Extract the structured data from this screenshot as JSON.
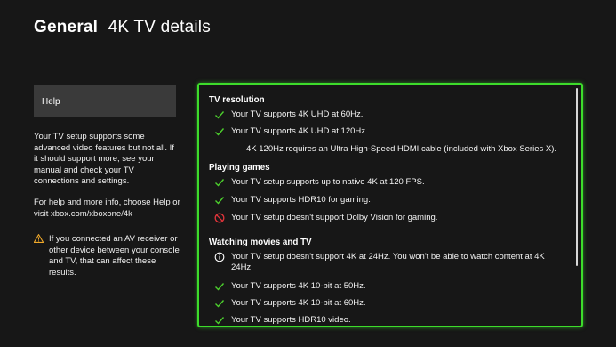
{
  "header": {
    "section": "General",
    "title": "4K TV details"
  },
  "help": {
    "button_label": "Help",
    "paragraph1": "Your TV setup supports some advanced video features but not all. If it should support more, see your manual and check your TV connections and settings.",
    "paragraph2": "For help and more info, choose Help or visit xbox.com/xboxone/4k",
    "warning": "If you connected an AV receiver or other device between your console and TV, that can affect these results."
  },
  "sections": {
    "tv_resolution": {
      "title": "TV resolution",
      "items": [
        {
          "icon": "check-icon",
          "text": "Your TV supports 4K UHD at 60Hz."
        },
        {
          "icon": "check-icon",
          "text": "Your TV supports 4K UHD at 120Hz."
        }
      ],
      "note": "4K 120Hz requires an Ultra High-Speed HDMI cable (included with Xbox Series X)."
    },
    "playing_games": {
      "title": "Playing games",
      "items": [
        {
          "icon": "check-icon",
          "text": "Your TV setup supports up to native 4K at 120 FPS."
        },
        {
          "icon": "check-icon",
          "text": "Your TV supports HDR10 for gaming."
        },
        {
          "icon": "prohibited-icon",
          "text": "Your TV setup doesn't support Dolby Vision for gaming."
        }
      ]
    },
    "watching_movies": {
      "title": "Watching movies and TV",
      "items": [
        {
          "icon": "info-icon",
          "text": "Your TV setup doesn't support 4K at 24Hz. You won't be able to watch content at 4K 24Hz."
        },
        {
          "icon": "check-icon",
          "text": "Your TV supports 4K 10-bit at 50Hz."
        },
        {
          "icon": "check-icon",
          "text": "Your TV supports 4K 10-bit at 60Hz."
        },
        {
          "icon": "check-icon",
          "text": "Your TV supports HDR10 video."
        }
      ]
    }
  },
  "colors": {
    "accent": "#3ddc2b",
    "check": "#4ccf2d",
    "prohibited": "#e0343a",
    "warning": "#f0a92a"
  }
}
